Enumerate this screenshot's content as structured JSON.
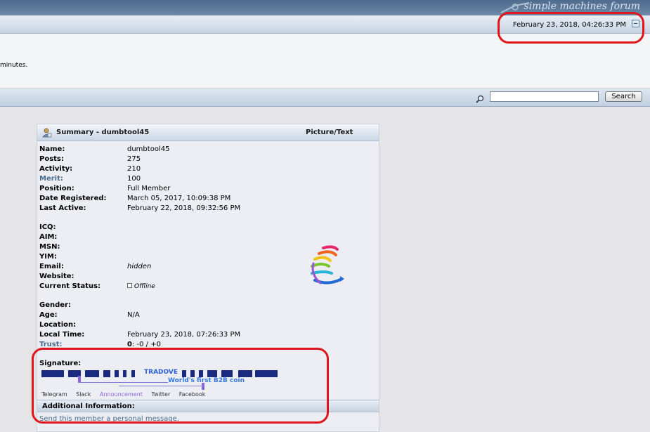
{
  "header": {
    "brand": "simple machines forum",
    "current_date": "February 23, 2018, 04:26:33 PM"
  },
  "news": {
    "text": "minutes."
  },
  "search": {
    "button_label": "Search",
    "value": ""
  },
  "profile": {
    "title": "Summary - dumbtool45",
    "right_title": "Picture/Text",
    "fields": [
      {
        "label": "Name:",
        "value": "dumbtool45"
      },
      {
        "label": "Posts:",
        "value": "275"
      },
      {
        "label": "Activity:",
        "value": "210"
      },
      {
        "label": "Merit:",
        "value": "100"
      },
      {
        "label": "Position:",
        "value": "Full Member"
      },
      {
        "label": "Date Registered:",
        "value": "March 05, 2017, 10:09:38 PM"
      },
      {
        "label": "Last Active:",
        "value": "February 22, 2018, 09:32:56 PM"
      },
      {
        "label": "ICQ:",
        "value": ""
      },
      {
        "label": "AIM:",
        "value": ""
      },
      {
        "label": "MSN:",
        "value": ""
      },
      {
        "label": "YIM:",
        "value": ""
      },
      {
        "label": "Email:",
        "value": "hidden"
      },
      {
        "label": "Website:",
        "value": ""
      },
      {
        "label": "Current Status:",
        "value": "Offline"
      },
      {
        "label": "Gender:",
        "value": ""
      },
      {
        "label": "Age:",
        "value": "N/A"
      },
      {
        "label": "Location:",
        "value": ""
      },
      {
        "label": "Local Time:",
        "value": "February 23, 2018, 07:26:33 PM"
      },
      {
        "label": "Trust:",
        "value_bold": "0",
        "value": ": -0 / +0"
      }
    ],
    "signature_label": "Signature:",
    "signature": {
      "brand": "TRADOVE",
      "slogan": "World's first B2B coin",
      "links": [
        "Telegram",
        "Slack",
        "Announcement",
        "Twitter",
        "Facebook"
      ]
    },
    "additional_title": "Additional Information:",
    "pm_link": "Send this member a personal message."
  },
  "colors": {
    "annotation_red": "#e0151c",
    "link_blue": "#476c8e",
    "header_blue": "#4e6a8c"
  }
}
